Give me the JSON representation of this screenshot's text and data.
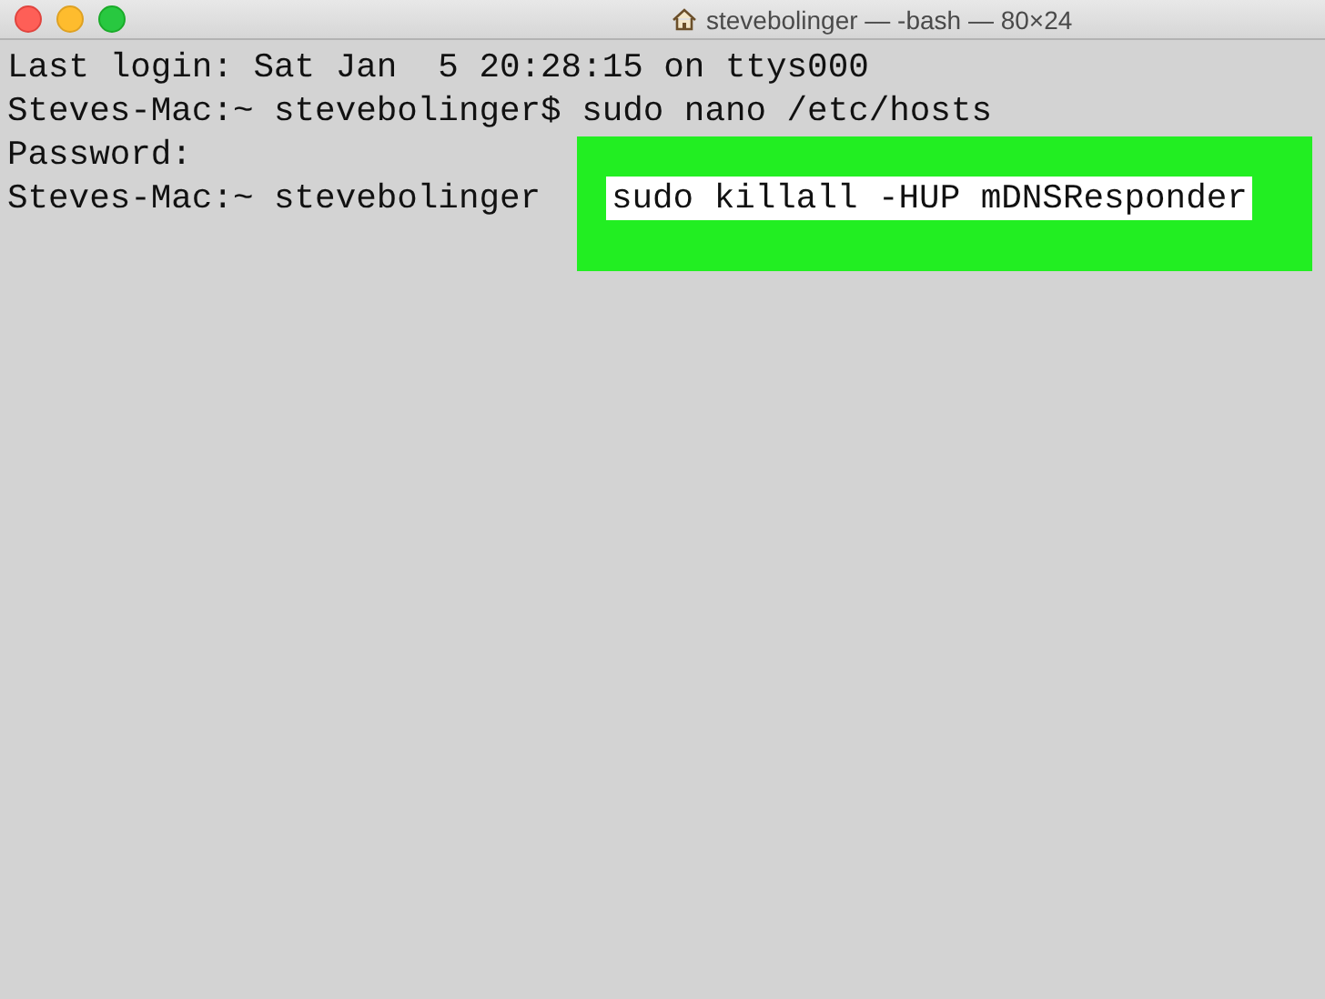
{
  "window": {
    "title": "stevebolinger — -bash — 80×24"
  },
  "lines": [
    {
      "kind": "output",
      "text": "Last login: Sat Jan  5 20:28:15 on ttys000"
    },
    {
      "kind": "prompt",
      "prompt": "Steves-Mac:~ stevebolinger$",
      "command": "sudo nano /etc/hosts"
    },
    {
      "kind": "output",
      "text": "Password:"
    },
    {
      "kind": "highlighted",
      "prompt": "Steves-Mac:~ stevebolinger",
      "command": "sudo killall -HUP mDNSResponder"
    }
  ]
}
